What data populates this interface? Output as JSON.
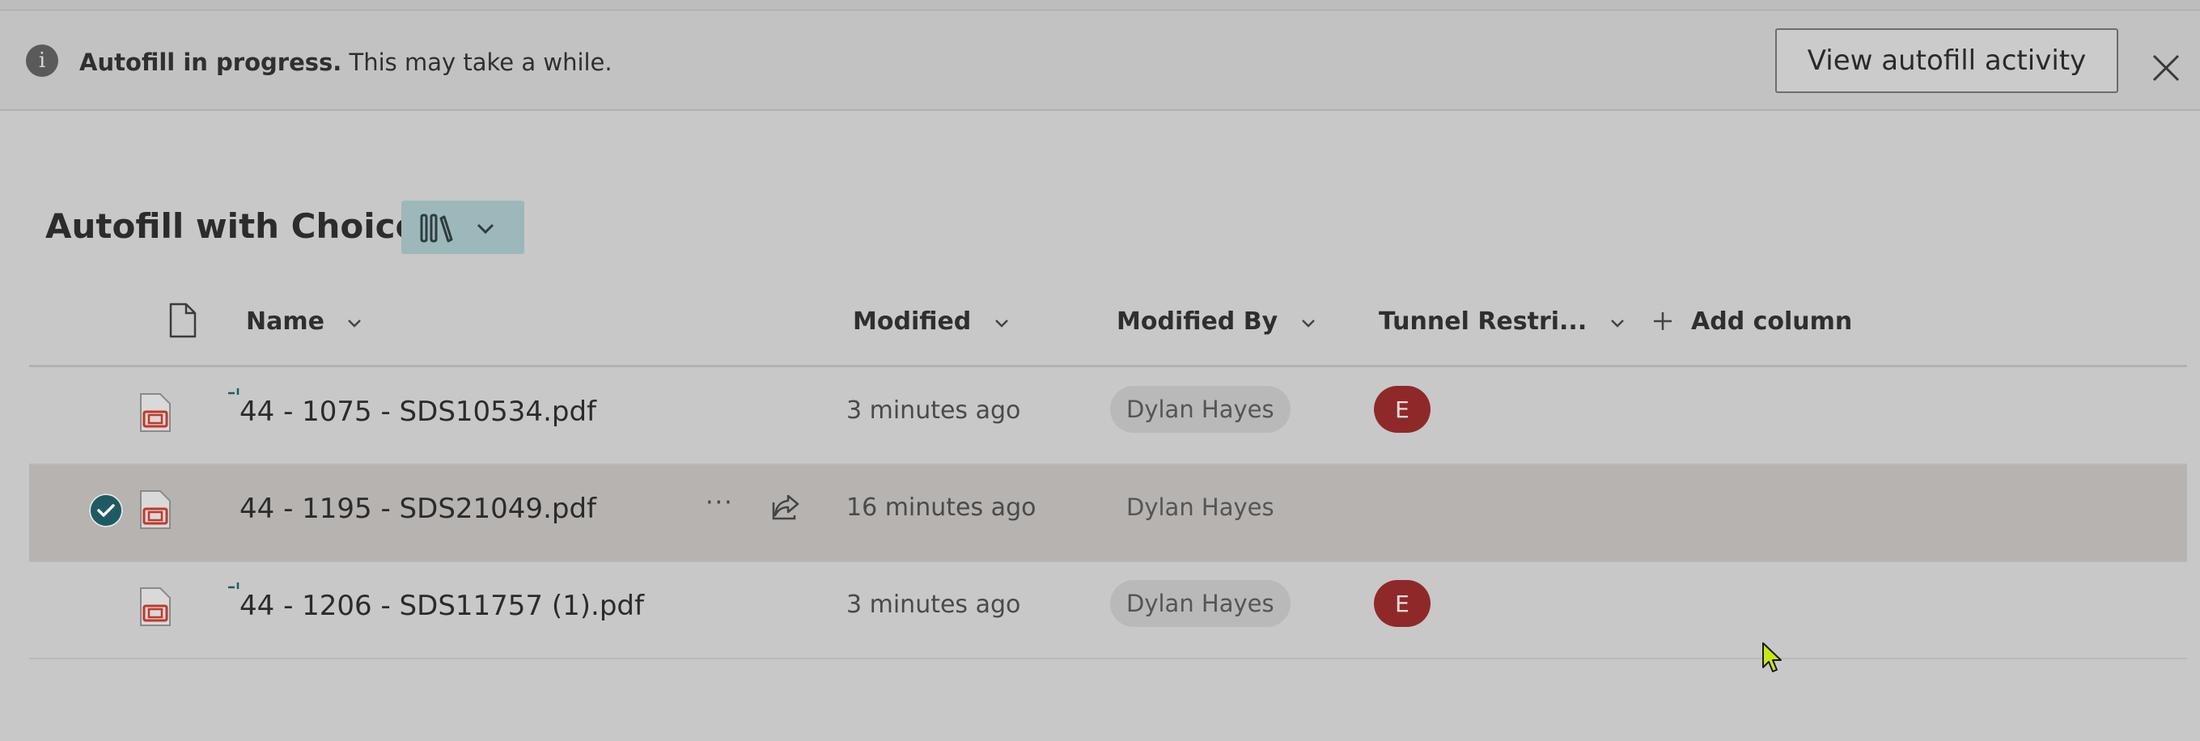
{
  "banner": {
    "title_bold": "Autofill in progress.",
    "message": " This may take a while.",
    "view_button": "View autofill activity",
    "info_icon": "i",
    "close_icon": "close-icon"
  },
  "library": {
    "title": "Autofill with Choices",
    "view_icon": "library-icon"
  },
  "columns": {
    "name": "Name",
    "modified": "Modified",
    "modified_by": "Modified By",
    "tunnel": "Tunnel Restri...",
    "add_column": "Add column"
  },
  "rows": [
    {
      "name": "44 - 1075 - SDS10534.pdf",
      "modified": "3 minutes ago",
      "modified_by": "Dylan Hayes",
      "tunnel": "E",
      "selected": false
    },
    {
      "name": "44 - 1195 - SDS21049.pdf",
      "modified": "16 minutes ago",
      "modified_by": "Dylan Hayes",
      "tunnel": "",
      "selected": true,
      "more": "···"
    },
    {
      "name": "44 - 1206 - SDS11757 (1).pdf",
      "modified": "3 minutes ago",
      "modified_by": "Dylan Hayes",
      "tunnel": "E",
      "selected": false
    }
  ],
  "colors": {
    "accent": "#1f5a63",
    "badge": "#8f2929",
    "view_switch": "#9db8ba"
  }
}
